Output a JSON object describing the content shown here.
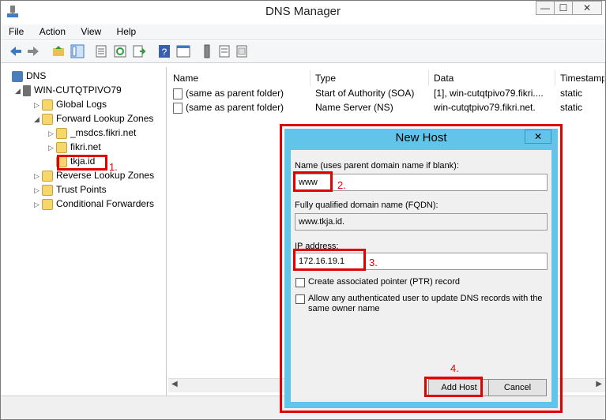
{
  "window": {
    "title": "DNS Manager",
    "minimize": "—",
    "maximize": "☐",
    "close": "✕"
  },
  "menu": [
    "File",
    "Action",
    "View",
    "Help"
  ],
  "tree": {
    "dns": "DNS",
    "server": "WIN-CUTQTPIVO79",
    "global_logs": "Global Logs",
    "forward_zones": "Forward Lookup Zones",
    "msdcs": "_msdcs.fikri.net",
    "fikri": "fikri.net",
    "tkja": "tkja.id",
    "reverse_zones": "Reverse Lookup Zones",
    "trust_points": "Trust Points",
    "conditional_forwarders": "Conditional Forwarders"
  },
  "list": {
    "headers": [
      "Name",
      "Type",
      "Data",
      "Timestamp"
    ],
    "rows": [
      {
        "name": "(same as parent folder)",
        "type": "Start of Authority (SOA)",
        "data": "[1], win-cutqtpivo79.fikri....",
        "timestamp": "static"
      },
      {
        "name": "(same as parent folder)",
        "type": "Name Server (NS)",
        "data": "win-cutqtpivo79.fikri.net.",
        "timestamp": "static"
      }
    ]
  },
  "dialog": {
    "title": "New Host",
    "close": "✕",
    "name_label": "Name (uses parent domain name if blank):",
    "name_value": "www",
    "fqdn_label": "Fully qualified domain name (FQDN):",
    "fqdn_value": "www.tkja.id.",
    "ip_label": "IP address:",
    "ip_value": "172.16.19.1",
    "ptr_label": "Create associated pointer (PTR) record",
    "auth_label_1": "Allow any authenticated user to update DNS records with the",
    "auth_label_2": "same owner name",
    "add_host": "Add Host",
    "cancel": "Cancel"
  },
  "annotations": [
    "1.",
    "2.",
    "3.",
    "4."
  ]
}
